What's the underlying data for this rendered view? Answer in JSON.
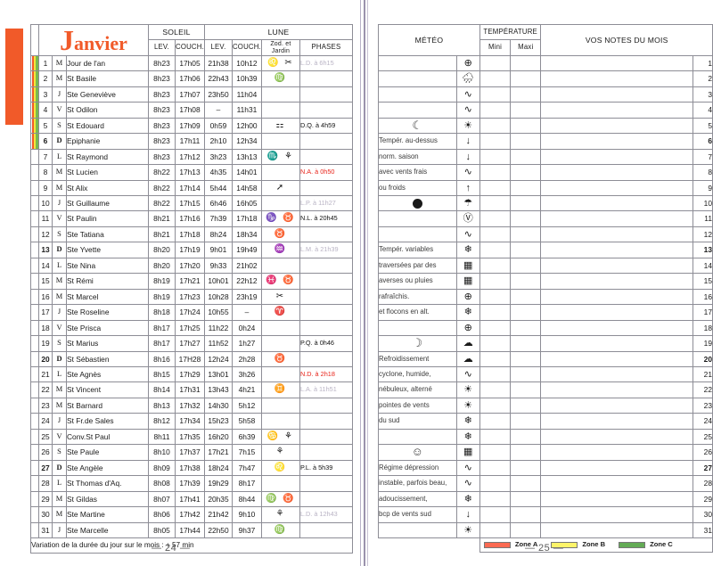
{
  "left_page": {
    "month_title": "Janvier",
    "month_initial": "J",
    "month_rest": "anvier",
    "headers": {
      "soleil": "SOLEIL",
      "lune": "LUNE",
      "lev": "LEV.",
      "couch": "COUCH.",
      "mlev": "LEV.",
      "mcouch": "COUCH.",
      "zod": "Zod. et Jardin",
      "zod_l1": "Zod. et",
      "zod_l2": "Jardin",
      "phases": "PHASES"
    },
    "footer_note": "Variation de la durée du jour sur le mois : + 57 min",
    "folio": "— 24 —",
    "rows": [
      {
        "day": "1",
        "dow": "M",
        "saint": "Jour de l'an",
        "slev": "8h23",
        "scou": "17h05",
        "mlev": "21h38",
        "mcou": "10h12",
        "zod": "♌ ✂",
        "phase": "L.D. à 6h15",
        "phase_color": "grey",
        "sunday": false,
        "zones": true
      },
      {
        "day": "2",
        "dow": "M",
        "saint": "St Basile",
        "slev": "8h23",
        "scou": "17h06",
        "mlev": "22h43",
        "mcou": "10h39",
        "zod": "♍",
        "phase": "",
        "phase_color": "black",
        "sunday": false,
        "zones": true
      },
      {
        "day": "3",
        "dow": "J",
        "saint": "Ste Geneviève",
        "slev": "8h23",
        "scou": "17h07",
        "mlev": "23h50",
        "mcou": "11h04",
        "zod": "",
        "phase": "",
        "phase_color": "black",
        "sunday": false,
        "zones": true
      },
      {
        "day": "4",
        "dow": "V",
        "saint": "St Odilon",
        "slev": "8h23",
        "scou": "17h08",
        "mlev": "–",
        "mcou": "11h31",
        "zod": "",
        "phase": "",
        "phase_color": "black",
        "sunday": false,
        "zones": true
      },
      {
        "day": "5",
        "dow": "S",
        "saint": "St Edouard",
        "slev": "8h23",
        "scou": "17h09",
        "mlev": "0h59",
        "mcou": "12h00",
        "zod": "⚏",
        "phase": "D.Q. à 4h59",
        "phase_color": "black",
        "sunday": false,
        "zones": true
      },
      {
        "day": "6",
        "dow": "D",
        "saint": "Epiphanie",
        "slev": "8h23",
        "scou": "17h11",
        "mlev": "2h10",
        "mcou": "12h34",
        "zod": "",
        "phase": "",
        "phase_color": "black",
        "sunday": true,
        "zones": true
      },
      {
        "day": "7",
        "dow": "L",
        "saint": "St Raymond",
        "slev": "8h23",
        "scou": "17h12",
        "mlev": "3h23",
        "mcou": "13h13",
        "zod": "♏ ⚘",
        "phase": "",
        "phase_color": "black",
        "sunday": false,
        "zones": false
      },
      {
        "day": "8",
        "dow": "M",
        "saint": "St Lucien",
        "slev": "8h22",
        "scou": "17h13",
        "mlev": "4h35",
        "mcou": "14h01",
        "zod": "",
        "phase": "N.A. à 0h50",
        "phase_color": "red",
        "sunday": false,
        "zones": false
      },
      {
        "day": "9",
        "dow": "M",
        "saint": "St Alix",
        "slev": "8h22",
        "scou": "17h14",
        "mlev": "5h44",
        "mcou": "14h58",
        "zod": "➚",
        "phase": "",
        "phase_color": "black",
        "sunday": false,
        "zones": false
      },
      {
        "day": "10",
        "dow": "J",
        "saint": "St Guillaume",
        "slev": "8h22",
        "scou": "17h15",
        "mlev": "6h46",
        "mcou": "16h05",
        "zod": "",
        "phase": "L.P. à 11h27",
        "phase_color": "grey",
        "sunday": false,
        "zones": false
      },
      {
        "day": "11",
        "dow": "V",
        "saint": "St Paulin",
        "slev": "8h21",
        "scou": "17h16",
        "mlev": "7h39",
        "mcou": "17h18",
        "zod": "♑ ♉",
        "phase": "N.L. à 20h45",
        "phase_color": "black",
        "sunday": false,
        "zones": false
      },
      {
        "day": "12",
        "dow": "S",
        "saint": "Ste Tatiana",
        "slev": "8h21",
        "scou": "17h18",
        "mlev": "8h24",
        "mcou": "18h34",
        "zod": "♉",
        "phase": "",
        "phase_color": "black",
        "sunday": false,
        "zones": false
      },
      {
        "day": "13",
        "dow": "D",
        "saint": "Ste Yvette",
        "slev": "8h20",
        "scou": "17h19",
        "mlev": "9h01",
        "mcou": "19h49",
        "zod": "♒",
        "phase": "L.M. à 21h39",
        "phase_color": "grey",
        "sunday": true,
        "zones": false
      },
      {
        "day": "14",
        "dow": "L",
        "saint": "Ste Nina",
        "slev": "8h20",
        "scou": "17h20",
        "mlev": "9h33",
        "mcou": "21h02",
        "zod": "",
        "phase": "",
        "phase_color": "black",
        "sunday": false,
        "zones": false
      },
      {
        "day": "15",
        "dow": "M",
        "saint": "St Rémi",
        "slev": "8h19",
        "scou": "17h21",
        "mlev": "10h01",
        "mcou": "22h12",
        "zod": "♓ ♉",
        "phase": "",
        "phase_color": "black",
        "sunday": false,
        "zones": false
      },
      {
        "day": "16",
        "dow": "M",
        "saint": "St Marcel",
        "slev": "8h19",
        "scou": "17h23",
        "mlev": "10h28",
        "mcou": "23h19",
        "zod": "✂",
        "phase": "",
        "phase_color": "black",
        "sunday": false,
        "zones": false
      },
      {
        "day": "17",
        "dow": "J",
        "saint": "Ste Roseline",
        "slev": "8h18",
        "scou": "17h24",
        "mlev": "10h55",
        "mcou": "–",
        "zod": "♈",
        "phase": "",
        "phase_color": "black",
        "sunday": false,
        "zones": false
      },
      {
        "day": "18",
        "dow": "V",
        "saint": "Ste Prisca",
        "slev": "8h17",
        "scou": "17h25",
        "mlev": "11h22",
        "mcou": "0h24",
        "zod": "",
        "phase": "",
        "phase_color": "black",
        "sunday": false,
        "zones": false
      },
      {
        "day": "19",
        "dow": "S",
        "saint": "St Marius",
        "slev": "8h17",
        "scou": "17h27",
        "mlev": "11h52",
        "mcou": "1h27",
        "zod": "",
        "phase": "P.Q. à 0h46",
        "phase_color": "black",
        "sunday": false,
        "zones": false
      },
      {
        "day": "20",
        "dow": "D",
        "saint": "St Sébastien",
        "slev": "8h16",
        "scou": "17H28",
        "mlev": "12h24",
        "mcou": "2h28",
        "zod": "♉",
        "phase": "",
        "phase_color": "black",
        "sunday": true,
        "zones": false
      },
      {
        "day": "21",
        "dow": "L",
        "saint": "Ste Agnès",
        "slev": "8h15",
        "scou": "17h29",
        "mlev": "13h01",
        "mcou": "3h26",
        "zod": "",
        "phase": "N.D. à 2h18",
        "phase_color": "red",
        "sunday": false,
        "zones": false
      },
      {
        "day": "22",
        "dow": "M",
        "saint": "St Vincent",
        "slev": "8h14",
        "scou": "17h31",
        "mlev": "13h43",
        "mcou": "4h21",
        "zod": "♊",
        "phase": "L.A. à 11h51",
        "phase_color": "grey",
        "sunday": false,
        "zones": false
      },
      {
        "day": "23",
        "dow": "M",
        "saint": "St Barnard",
        "slev": "8h13",
        "scou": "17h32",
        "mlev": "14h30",
        "mcou": "5h12",
        "zod": "",
        "phase": "",
        "phase_color": "black",
        "sunday": false,
        "zones": false
      },
      {
        "day": "24",
        "dow": "J",
        "saint": "St Fr.de Sales",
        "slev": "8h12",
        "scou": "17h34",
        "mlev": "15h23",
        "mcou": "5h58",
        "zod": "",
        "phase": "",
        "phase_color": "black",
        "sunday": false,
        "zones": false
      },
      {
        "day": "25",
        "dow": "V",
        "saint": "Conv.St Paul",
        "slev": "8h11",
        "scou": "17h35",
        "mlev": "16h20",
        "mcou": "6h39",
        "zod": "♋ ⚘",
        "phase": "",
        "phase_color": "black",
        "sunday": false,
        "zones": false
      },
      {
        "day": "26",
        "dow": "S",
        "saint": "Ste Paule",
        "slev": "8h10",
        "scou": "17h37",
        "mlev": "17h21",
        "mcou": "7h15",
        "zod": "⚘",
        "phase": "",
        "phase_color": "black",
        "sunday": false,
        "zones": false
      },
      {
        "day": "27",
        "dow": "D",
        "saint": "Ste Angèle",
        "slev": "8h09",
        "scou": "17h38",
        "mlev": "18h24",
        "mcou": "7h47",
        "zod": "♌",
        "phase": "P.L. à 5h39",
        "phase_color": "black",
        "sunday": true,
        "zones": false
      },
      {
        "day": "28",
        "dow": "L",
        "saint": "St Thomas d'Aq.",
        "slev": "8h08",
        "scou": "17h39",
        "mlev": "19h29",
        "mcou": "8h17",
        "zod": "",
        "phase": "",
        "phase_color": "black",
        "sunday": false,
        "zones": false
      },
      {
        "day": "29",
        "dow": "M",
        "saint": "St Gildas",
        "slev": "8h07",
        "scou": "17h41",
        "mlev": "20h35",
        "mcou": "8h44",
        "zod": "♍ ♉",
        "phase": "",
        "phase_color": "black",
        "sunday": false,
        "zones": false
      },
      {
        "day": "30",
        "dow": "M",
        "saint": "Ste Martine",
        "slev": "8h06",
        "scou": "17h42",
        "mlev": "21h42",
        "mcou": "9h10",
        "zod": "⚘",
        "phase": "L.D. à 12h43",
        "phase_color": "grey",
        "sunday": false,
        "zones": false
      },
      {
        "day": "31",
        "dow": "J",
        "saint": "Ste Marcelle",
        "slev": "8h05",
        "scou": "17h44",
        "mlev": "22h50",
        "mcou": "9h37",
        "zod": "♍",
        "phase": "",
        "phase_color": "black",
        "sunday": false,
        "zones": false
      }
    ]
  },
  "right_page": {
    "headers": {
      "meteo": "MÉTÉO",
      "temperature": "TEMPÉRATURE",
      "mini": "Mini",
      "maxi": "Maxi",
      "notes": "VOS NOTES DU MOIS"
    },
    "forecast_lines": [
      "",
      "",
      "",
      "",
      "",
      "Tempér. au-dessus",
      "norm. saison",
      "avec vents frais",
      "ou froids",
      "",
      "",
      "",
      "Tempér. variables",
      "traversées par des",
      "averses ou pluies",
      "rafraîchis.",
      "et flocons en alt.",
      "",
      "",
      "Refroidissement",
      "cyclone, humide,",
      "nébuleux, alterné",
      "pointes de vents",
      "du sud",
      "",
      "",
      "Régime dépression",
      "instable, parfois beau,",
      "adoucissement,",
      "bcp de vents sud",
      ""
    ],
    "forecast_glyphs": [
      "",
      "",
      "",
      "",
      "moon-crescent",
      "",
      "",
      "",
      "",
      "moon-new-dot",
      "",
      "",
      "",
      "",
      "",
      "",
      "",
      "",
      "moon-first-quarter",
      "",
      "",
      "",
      "",
      "",
      "",
      "moon-full-face",
      "",
      "",
      "",
      "",
      ""
    ],
    "weather_symbols": [
      "sun-cross",
      "cloud-rain",
      "wave",
      "wave",
      "sun-rays",
      "arrow-down",
      "arrow-down",
      "wave",
      "arrow-up",
      "cloud-drizzle",
      "circle-v",
      "wave",
      "snowflake",
      "grid",
      "grid",
      "sun-cross",
      "snowflake",
      "sun-cross",
      "cloud",
      "cloud",
      "wave",
      "sun-rays",
      "sun-rays",
      "snowflake",
      "snowflake",
      "grid",
      "wave",
      "wave",
      "snowflake",
      "arrow-down",
      "sun-rays"
    ],
    "day_numbers": [
      "1",
      "2",
      "3",
      "4",
      "5",
      "6",
      "7",
      "8",
      "9",
      "10",
      "11",
      "12",
      "13",
      "14",
      "15",
      "16",
      "17",
      "18",
      "19",
      "20",
      "21",
      "22",
      "23",
      "24",
      "25",
      "26",
      "27",
      "28",
      "29",
      "30",
      "31"
    ],
    "sundays": [
      6,
      13,
      20,
      27
    ],
    "legend": [
      {
        "label": "Zone A",
        "color": "#fb6a52"
      },
      {
        "label": "Zone B",
        "color": "#fdf46a"
      },
      {
        "label": "Zone C",
        "color": "#63ab55"
      }
    ],
    "folio": "— 25 —"
  }
}
